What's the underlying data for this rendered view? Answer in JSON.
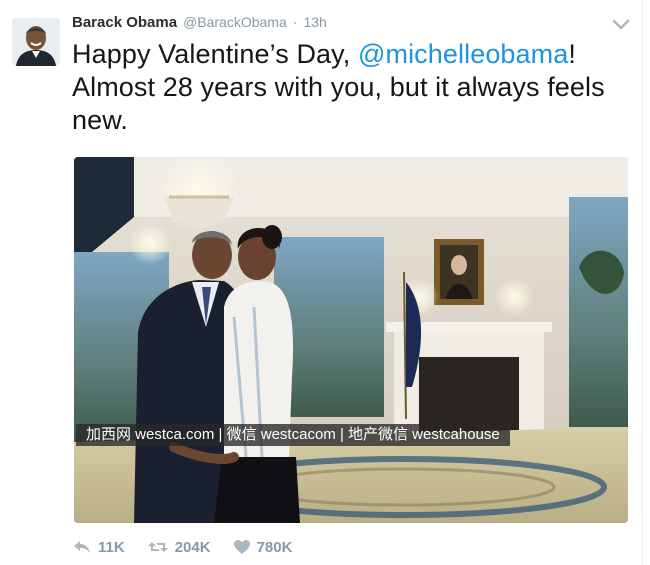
{
  "tweet": {
    "display_name": "Barack Obama",
    "handle": "@BarackObama",
    "separator": "·",
    "time": "13h",
    "text_line1_prefix": "Happy Valentine’s Day, ",
    "mention": "@michelleobama",
    "text_line1_suffix": "!",
    "text_rest": "Almost 28 years with you, but it always feels new."
  },
  "media": {
    "watermark": "加西网 westca.com | 微信 westcacom | 地产微信 westcahouse"
  },
  "actions": {
    "reply_count": "11K",
    "retweet_count": "204K",
    "like_count": "780K"
  },
  "icons": {
    "menu": "chevron-down-icon",
    "reply": "reply-icon",
    "retweet": "retweet-icon",
    "like": "heart-icon"
  },
  "colors": {
    "link": "#1b95e0",
    "muted": "#8899a6",
    "text": "#14171a"
  }
}
